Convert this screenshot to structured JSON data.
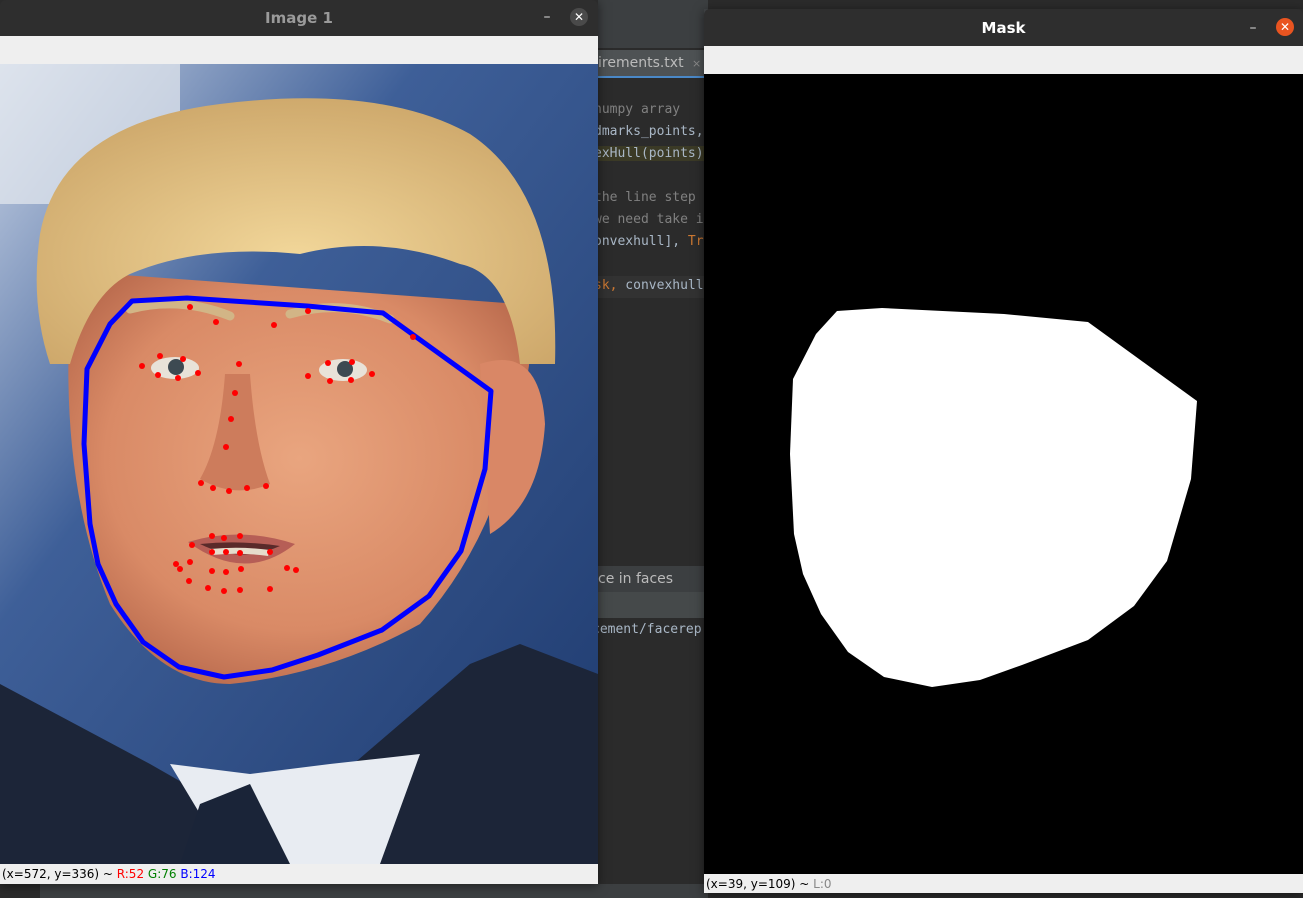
{
  "ide": {
    "tab_label": "irements.txt",
    "tab_close": "×",
    "code_lines": [
      {
        "text": "numpy array",
        "class": "comment"
      },
      {
        "text": "dmarks_points,",
        "class": ""
      },
      {
        "text": "exHull(points)",
        "class": "hl"
      },
      {
        "text": "",
        "class": ""
      },
      {
        "text": "the line step",
        "class": "comment"
      },
      {
        "text": "we need take i",
        "class": "comment"
      },
      {
        "text": "onvexhull], Tr",
        "class": "mixed"
      },
      {
        "text": "",
        "class": ""
      },
      {
        "text": "sk, convexhull",
        "class": "mixed2"
      }
    ],
    "panel_header": "ce in faces",
    "console_line": "cement/facerep"
  },
  "image_window": {
    "title": "Image 1",
    "minimize_label": "–",
    "close_label": "✕",
    "status": {
      "coords": "(x=572, y=336) ~ ",
      "r": "R:52",
      "g": "G:76",
      "b": "B:124"
    },
    "hull_color": "#0000ff",
    "landmark_color": "#ff0000"
  },
  "mask_window": {
    "title": "Mask",
    "minimize_label": "–",
    "close_label": "✕",
    "status": {
      "coords": "(x=39, y=109) ~ ",
      "l": "L:0"
    },
    "background_color": "#000000",
    "mask_color": "#ffffff"
  },
  "colors": {
    "close_button_active": "#e95420",
    "close_button_inactive": "#4a4a4a",
    "titlebar": "#2e2e2e"
  }
}
